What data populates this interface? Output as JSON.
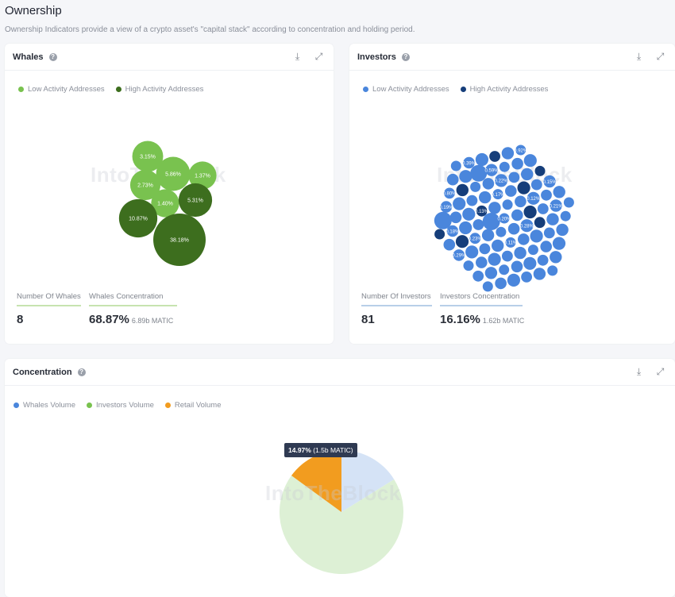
{
  "page": {
    "title": "Ownership",
    "subtitle": "Ownership Indicators provide a view of a crypto asset's \"capital stack\" according to concentration and holding period."
  },
  "watermark": "IntoTheBlock",
  "whales": {
    "title": "Whales",
    "legend": [
      {
        "label": "Low Activity Addresses",
        "color": "#79c24f"
      },
      {
        "label": "High Activity Addresses",
        "color": "#3d6e1e"
      }
    ],
    "bubbles": [
      {
        "label": "3.15%",
        "value": 3.15,
        "activity": "low"
      },
      {
        "label": "5.86%",
        "value": 5.86,
        "activity": "low"
      },
      {
        "label": "1.37%",
        "value": 1.37,
        "activity": "low"
      },
      {
        "label": "2.73%",
        "value": 2.73,
        "activity": "low"
      },
      {
        "label": "1.40%",
        "value": 1.4,
        "activity": "low"
      },
      {
        "label": "5.31%",
        "value": 5.31,
        "activity": "high"
      },
      {
        "label": "10.87%",
        "value": 10.87,
        "activity": "high"
      },
      {
        "label": "38.18%",
        "value": 38.18,
        "activity": "high"
      }
    ],
    "stats": {
      "count_label": "Number Of Whales",
      "count_value": "8",
      "concentration_label": "Whales Concentration",
      "concentration_value": "68.87%",
      "concentration_sub": "6.89b MATIC"
    }
  },
  "investors": {
    "title": "Investors",
    "legend": [
      {
        "label": "Low Activity Addresses",
        "color": "#4a86dc"
      },
      {
        "label": "High Activity Addresses",
        "color": "#163e7a"
      }
    ],
    "visible_bubble_labels": [
      "0.39%",
      "0.92%",
      "0.59%",
      "0.80%",
      "0.22%",
      "0.19%",
      "0.17%",
      "0.15%",
      "0.13%",
      "0.12%",
      "0.18%",
      "0.20%",
      "0.21%",
      "0.23%",
      "0.28%",
      "0.29%",
      "0.11%"
    ],
    "stats": {
      "count_label": "Number Of Investors",
      "count_value": "81",
      "concentration_label": "Investors Concentration",
      "concentration_value": "16.16%",
      "concentration_sub": "1.62b MATIC"
    }
  },
  "concentration": {
    "title": "Concentration",
    "tooltip_value": "14.97%",
    "tooltip_sub": "(1.5b MATIC)"
  },
  "chart_data": [
    {
      "type": "scatter",
      "title": "Whales",
      "series": [
        {
          "name": "Low Activity Addresses",
          "values": [
            3.15,
            5.86,
            1.37,
            2.73,
            1.4
          ]
        },
        {
          "name": "High Activity Addresses",
          "values": [
            5.31,
            10.87,
            38.18
          ]
        }
      ]
    },
    {
      "type": "pie",
      "title": "Concentration",
      "categories": [
        "Whales Volume",
        "Investors Volume",
        "Retail Volume"
      ],
      "values": [
        68.87,
        16.16,
        14.97
      ],
      "colors": [
        "#4a86dc",
        "#79c24f",
        "#f29c1f"
      ],
      "legend": "top-left"
    }
  ]
}
